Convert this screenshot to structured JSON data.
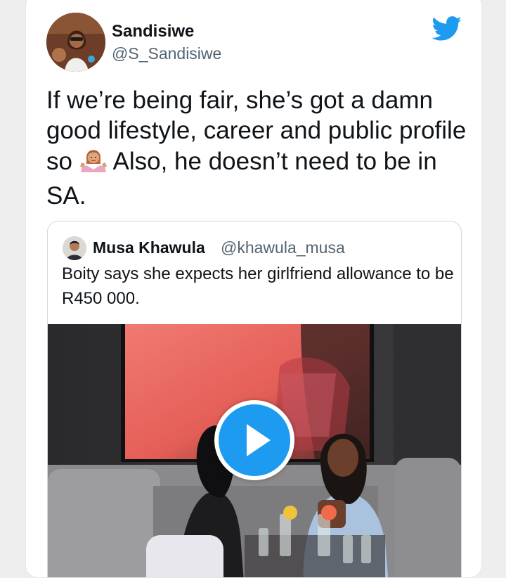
{
  "tweet": {
    "author": {
      "display_name": "Sandisiwe",
      "handle": "@S_Sandisiwe",
      "avatar_icon": "profile-photo"
    },
    "text_part1": "If we’re being fair, she’s got a damn good lifestyle, career and public profile so",
    "emoji": "person-shrugging-emoji",
    "text_part2": "Also, he doesn’t need to be in SA.",
    "platform_icon": "twitter-bird-icon"
  },
  "quoted_tweet": {
    "author": {
      "display_name": "Musa Khawula",
      "handle": "@khawula_musa",
      "avatar_icon": "profile-photo"
    },
    "text": "Boity says she expects her girlfriend allowance to be R450 000.",
    "media": {
      "type": "video",
      "play_icon": "play-icon"
    }
  },
  "colors": {
    "twitter_blue": "#1d9bf0",
    "text": "#0f1419",
    "secondary_text": "#536471",
    "border": "#cfd9de"
  }
}
